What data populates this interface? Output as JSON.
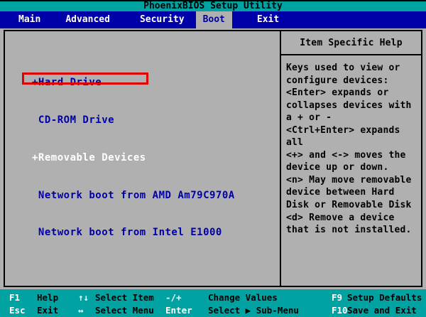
{
  "title": "PhoenixBIOS Setup Utility",
  "menu": {
    "tabs": [
      {
        "label": "Main",
        "active": false
      },
      {
        "label": "Advanced",
        "active": false
      },
      {
        "label": "Security",
        "active": false
      },
      {
        "label": "Boot",
        "active": true
      },
      {
        "label": "Exit",
        "active": false
      }
    ]
  },
  "boot": {
    "items": [
      "+Hard Drive",
      " CD-ROM Drive",
      "+Removable Devices",
      " Network boot from AMD Am79C970A",
      " Network boot from Intel E1000"
    ],
    "selected_index": 2,
    "selected_label": "+Removable Devices"
  },
  "help": {
    "header": "Item Specific Help",
    "lines": [
      "Keys used to view or",
      "configure devices:",
      "<Enter> expands or",
      "collapses devices with",
      "a + or -",
      "<Ctrl+Enter> expands",
      "all",
      "<+> and <-> moves the",
      "device up or down.",
      "<n> May move removable",
      "device between Hard",
      "Disk or Removable Disk",
      "<d> Remove a device",
      "that is not installed."
    ]
  },
  "keybar": {
    "rows": [
      {
        "pairs": [
          {
            "key": "F1",
            "label": "Help"
          },
          {
            "key": "↑↓",
            "label": "Select Item"
          },
          {
            "key": "-/+",
            "label": "Change Values"
          },
          {
            "key": "F9",
            "label": "Setup Defaults"
          }
        ]
      },
      {
        "pairs": [
          {
            "key": "Esc",
            "label": "Exit"
          },
          {
            "key": "↔",
            "label": "Select Menu"
          },
          {
            "key": "Enter",
            "label": "Select ▶ Sub-Menu"
          },
          {
            "key": "F10",
            "label": "Save and Exit"
          }
        ]
      }
    ]
  },
  "colors": {
    "teal": "#00a2a2",
    "blue": "#0000a8",
    "gray": "#b0b0b0",
    "text_blue": "#0000a8",
    "annotation_red": "#e10000"
  }
}
